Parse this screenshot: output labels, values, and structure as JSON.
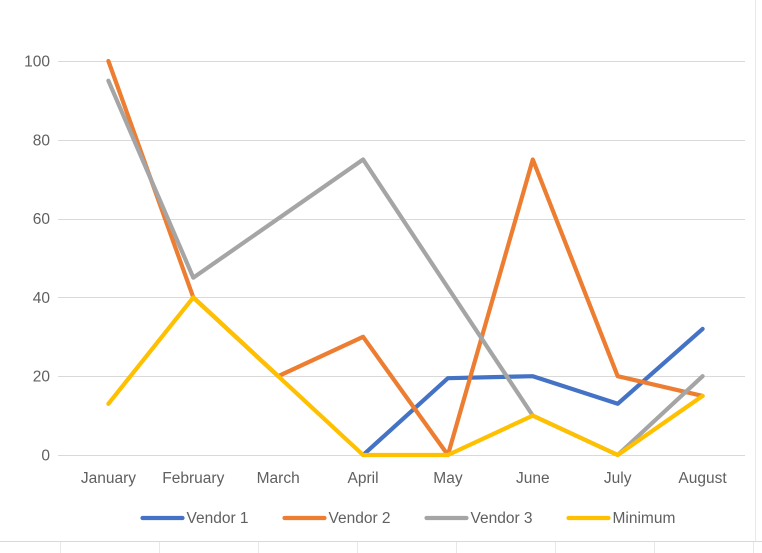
{
  "chart_data": {
    "type": "line",
    "title": "",
    "xlabel": "",
    "ylabel": "",
    "categories": [
      "January",
      "February",
      "March",
      "April",
      "May",
      "June",
      "July",
      "August"
    ],
    "series": [
      {
        "name": "Vendor 1",
        "color": "#4472C4",
        "values": [
          null,
          null,
          null,
          0,
          19.5,
          20,
          13,
          32
        ]
      },
      {
        "name": "Vendor 2",
        "color": "#ED7D31",
        "values": [
          100,
          40,
          20,
          30,
          0,
          75,
          20,
          15
        ]
      },
      {
        "name": "Vendor 3",
        "color": "#A5A5A5",
        "values": [
          95,
          45,
          60,
          75,
          42.5,
          10,
          0,
          20
        ]
      },
      {
        "name": "Minimum",
        "color": "#FFC000",
        "values": [
          13,
          40,
          20,
          0,
          0,
          10,
          0,
          15
        ]
      }
    ],
    "ylim": [
      0,
      100
    ],
    "yticks": [
      0,
      20,
      40,
      60,
      80,
      100
    ],
    "ytick_labels": [
      "0",
      "20",
      "40",
      "60",
      "80",
      "100"
    ],
    "grid": true,
    "legend_position": "bottom",
    "legend_entries": [
      "Vendor 1",
      "Vendor 2",
      "Vendor 3",
      "Minimum"
    ],
    "colors": {
      "vendor_1": "#4472C4",
      "vendor_2": "#ED7D31",
      "vendor_3": "#A5A5A5",
      "minimum": "#FFC000",
      "gridline": "#D9D9D9",
      "axis_text": "#606060",
      "background": "#FFFFFF"
    }
  }
}
